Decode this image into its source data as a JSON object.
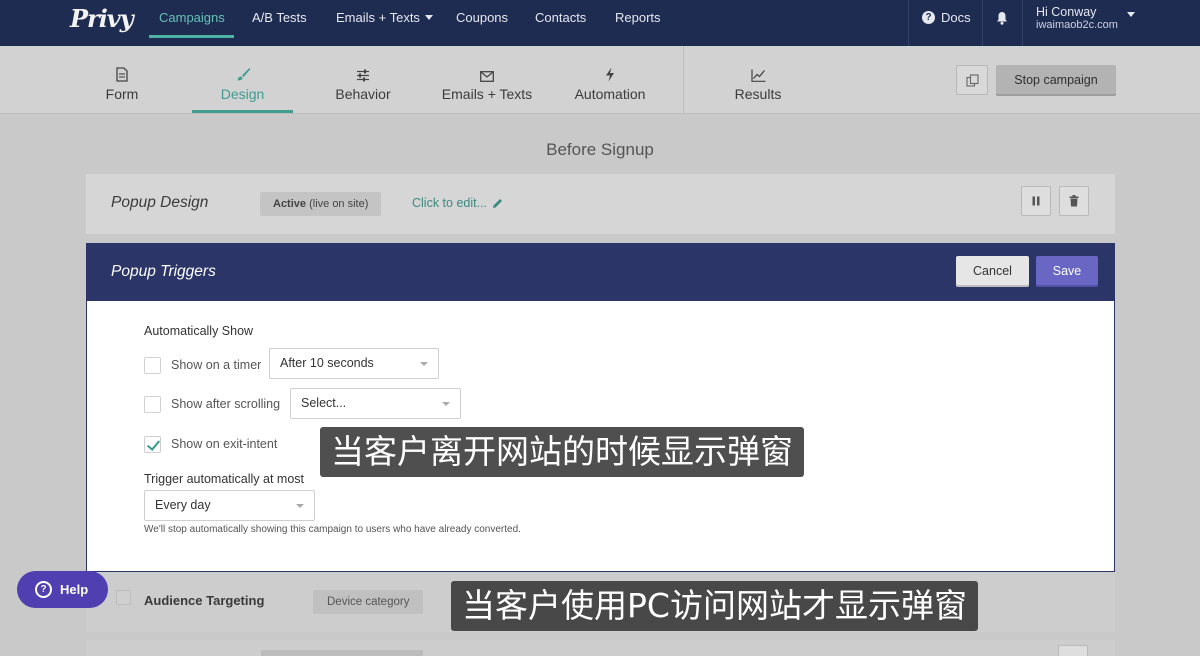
{
  "topnav": {
    "logo": "Privy",
    "items": [
      {
        "label": "Campaigns",
        "active": true
      },
      {
        "label": "A/B Tests"
      },
      {
        "label": "Emails + Texts",
        "dropdown": true
      },
      {
        "label": "Coupons"
      },
      {
        "label": "Contacts"
      },
      {
        "label": "Reports"
      }
    ],
    "docs_label": "Docs",
    "user_greeting": "Hi Conway",
    "user_email": "iwaimaob2c.com"
  },
  "tabs": [
    {
      "label": "Form",
      "icon": "document-icon"
    },
    {
      "label": "Design",
      "icon": "brush-icon",
      "active": true
    },
    {
      "label": "Behavior",
      "icon": "sliders-icon"
    },
    {
      "label": "Emails + Texts",
      "icon": "envelope-icon"
    },
    {
      "label": "Automation",
      "icon": "lightning-icon"
    },
    {
      "label": "Results",
      "icon": "chart-icon"
    }
  ],
  "stop_campaign_label": "Stop campaign",
  "section_title": "Before Signup",
  "popup_design": {
    "title": "Popup Design",
    "status_bold": "Active",
    "status_note": "(live on site)",
    "edit_link": "Click to edit..."
  },
  "triggers": {
    "title": "Popup Triggers",
    "cancel_label": "Cancel",
    "save_label": "Save",
    "auto_show_label": "Automatically Show",
    "options": [
      {
        "label": "Show on a timer",
        "checked": false,
        "select_value": "After 10 seconds"
      },
      {
        "label": "Show after scrolling",
        "checked": false,
        "select_value": "Select..."
      },
      {
        "label": "Show on exit-intent",
        "checked": true
      }
    ],
    "frequency_label": "Trigger automatically at most",
    "frequency_value": "Every day",
    "hint": "We'll stop automatically showing this campaign to users who have already converted."
  },
  "audience": {
    "title": "Audience Targeting",
    "badge": "Device category"
  },
  "help_label": "Help",
  "subtitles": [
    "当客户离开网站的时候显示弹窗",
    "当客户使用PC访问网站才显示弹窗"
  ],
  "colors": {
    "nav_bg": "#1f2c52",
    "accent_teal": "#3f9c8f",
    "trigger_header": "#2b3568",
    "save_purple": "#6a67c4",
    "help_purple": "#4f3fb0"
  }
}
